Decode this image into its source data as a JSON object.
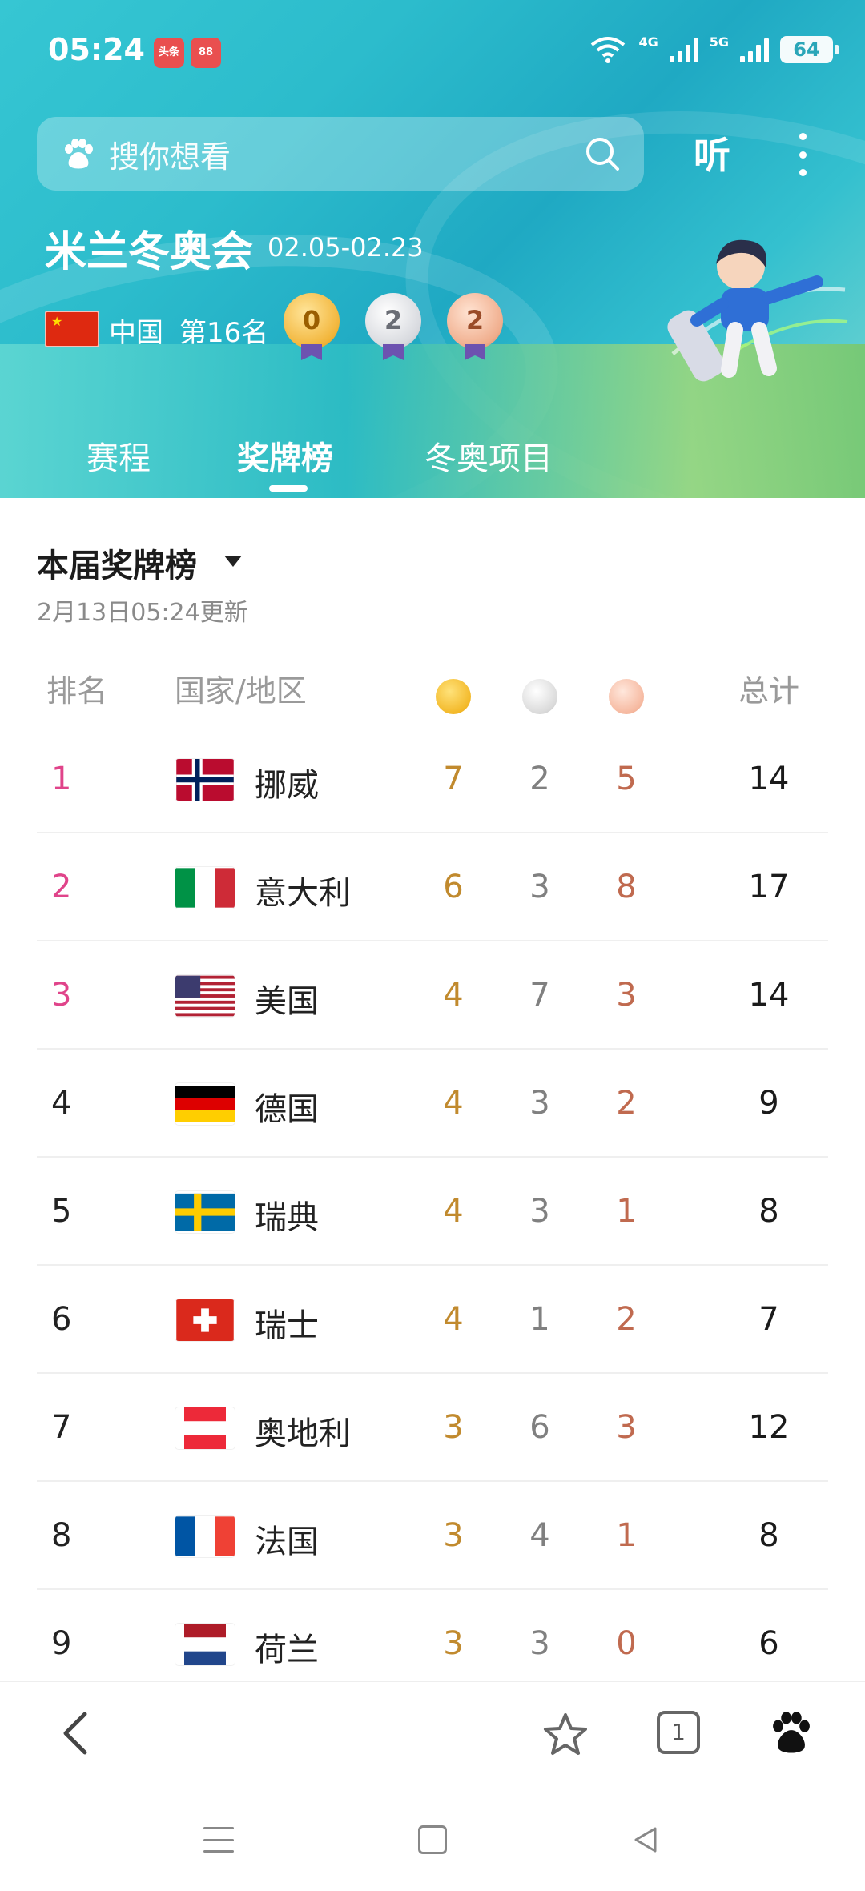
{
  "status": {
    "time": "05:24",
    "app1": "头条",
    "app2": "88",
    "net1": "4G",
    "net2": "5G",
    "battery": "64"
  },
  "search": {
    "placeholder": "搜你想看",
    "listen": "听"
  },
  "event": {
    "title": "米兰冬奥会",
    "dates": "02.05-02.23",
    "country": "中国",
    "rank": "第16名",
    "gold": "0",
    "silver": "2",
    "bronze": "2"
  },
  "tabs": [
    "赛程",
    "奖牌榜",
    "冬奥项目"
  ],
  "board": {
    "title": "本届奖牌榜",
    "updated": "2月13日05:24更新"
  },
  "headers": {
    "rank": "排名",
    "country": "国家/地区",
    "total": "总计"
  },
  "rows": [
    {
      "rank": "1",
      "country": "挪威",
      "gold": "7",
      "silver": "2",
      "bronze": "5",
      "total": "14"
    },
    {
      "rank": "2",
      "country": "意大利",
      "gold": "6",
      "silver": "3",
      "bronze": "8",
      "total": "17"
    },
    {
      "rank": "3",
      "country": "美国",
      "gold": "4",
      "silver": "7",
      "bronze": "3",
      "total": "14"
    },
    {
      "rank": "4",
      "country": "德国",
      "gold": "4",
      "silver": "3",
      "bronze": "2",
      "total": "9"
    },
    {
      "rank": "5",
      "country": "瑞典",
      "gold": "4",
      "silver": "3",
      "bronze": "1",
      "total": "8"
    },
    {
      "rank": "6",
      "country": "瑞士",
      "gold": "4",
      "silver": "1",
      "bronze": "2",
      "total": "7"
    },
    {
      "rank": "7",
      "country": "奥地利",
      "gold": "3",
      "silver": "6",
      "bronze": "3",
      "total": "12"
    },
    {
      "rank": "8",
      "country": "法国",
      "gold": "3",
      "silver": "4",
      "bronze": "1",
      "total": "8"
    },
    {
      "rank": "9",
      "country": "荷兰",
      "gold": "3",
      "silver": "3",
      "bronze": "0",
      "total": "6"
    }
  ],
  "nav": {
    "tab_count": "1"
  },
  "colors": {
    "rank_top": "#e0448a",
    "gold": "#c18a2e",
    "silver": "#808080",
    "bronze": "#c06a4f"
  },
  "icons": [
    "paw-icon",
    "search-icon",
    "more-icon",
    "back-icon",
    "star-icon",
    "tabs-icon",
    "menu-icon",
    "home-icon"
  ]
}
